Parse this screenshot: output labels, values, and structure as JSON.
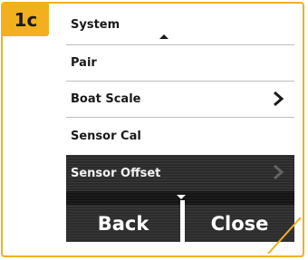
{
  "step_badge": "1c",
  "menu": {
    "items": [
      {
        "label": "System",
        "has_scroll_up": true
      },
      {
        "label": "Pair"
      },
      {
        "label": "Boat Scale",
        "has_chevron": true
      },
      {
        "label": "Sensor Cal"
      }
    ],
    "selected_item": {
      "label": "Sensor Offset",
      "has_chevron": true
    }
  },
  "buttons": {
    "back_label": "Back",
    "close_label": "Close"
  },
  "colors": {
    "accent": "#f2b01e",
    "panel_dark": "#141414",
    "button_bg": "#2c2c2c",
    "text_dark": "#1a1a1a"
  }
}
